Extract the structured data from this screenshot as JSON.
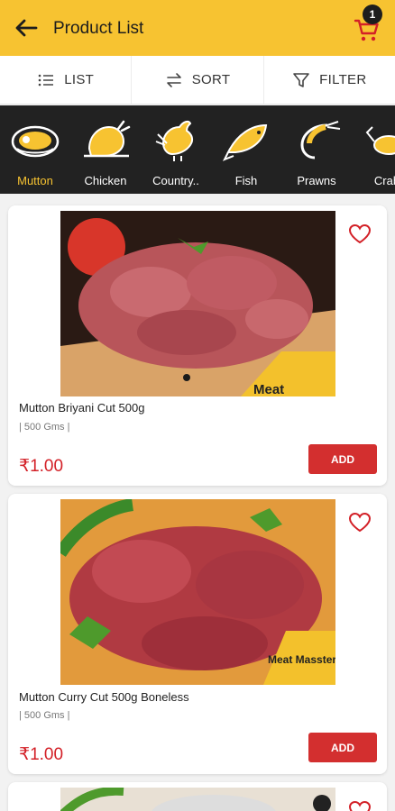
{
  "header": {
    "title": "Product List",
    "cart_count": "1"
  },
  "toolbar": {
    "list_label": "LIST",
    "sort_label": "SORT",
    "filter_label": "FILTER"
  },
  "categories": [
    {
      "label": "Mutton",
      "icon": "mutton-icon",
      "active": true
    },
    {
      "label": "Chicken",
      "icon": "chicken-icon"
    },
    {
      "label": "Country..",
      "icon": "country-chicken-icon"
    },
    {
      "label": "Fish",
      "icon": "fish-icon"
    },
    {
      "label": "Prawns",
      "icon": "prawn-icon"
    },
    {
      "label": "Crab",
      "icon": "crab-icon"
    }
  ],
  "products": [
    {
      "name": "Mutton Briyani Cut 500g",
      "weight": "| 500 Gms |",
      "price": "₹1.00",
      "add_label": "ADD",
      "logo_text": "Meat"
    },
    {
      "name": "Mutton Curry Cut 500g Boneless",
      "weight": "| 500 Gms |",
      "price": "₹1.00",
      "add_label": "ADD",
      "logo_text": "Meat Massterz"
    }
  ],
  "colors": {
    "brand_yellow": "#f7c331",
    "price_red": "#d32027",
    "add_red": "#d32f2f",
    "category_bg": "#222222"
  }
}
